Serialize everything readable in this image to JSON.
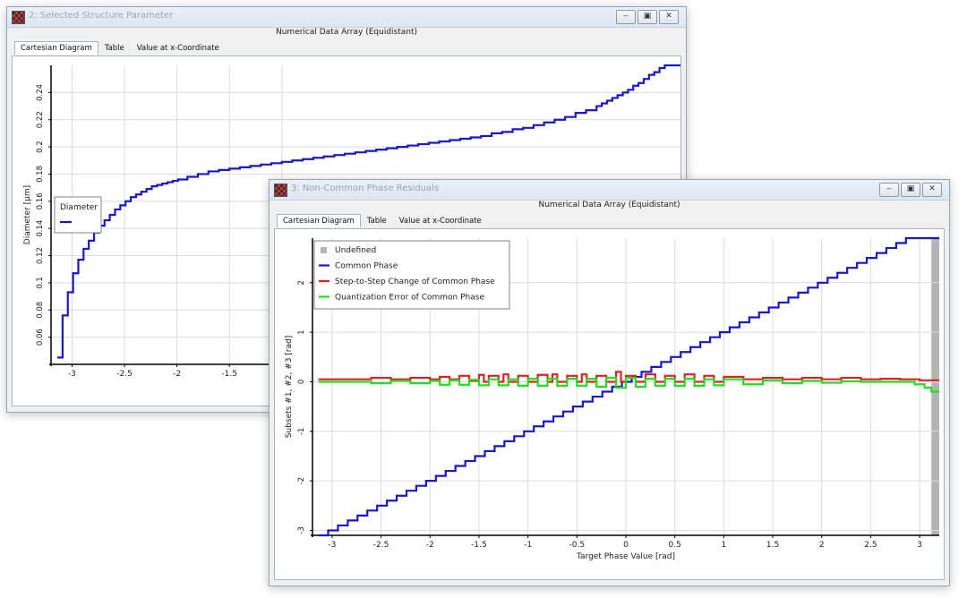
{
  "windows": [
    {
      "title": "2: Selected Structure Parameter",
      "subtitle": "Numerical Data Array (Equidistant)",
      "tabs": [
        "Cartesian Diagram",
        "Table",
        "Value at x-Coordinate"
      ],
      "active_tab": 0,
      "buttons": [
        "minimize",
        "restore",
        "close"
      ]
    },
    {
      "title": "3: Non-Common Phase Residuals",
      "subtitle": "Numerical Data Array (Equidistant)",
      "tabs": [
        "Cartesian Diagram",
        "Table",
        "Value at x-Coordinate"
      ],
      "active_tab": 0,
      "buttons": [
        "minimize",
        "restore",
        "close"
      ]
    }
  ],
  "chart_data": [
    {
      "type": "line",
      "step": true,
      "ylabel": "Diameter [µm]",
      "xlabel": "",
      "xlim": [
        -3.2,
        2.8
      ],
      "ylim": [
        0.04,
        0.26
      ],
      "xticks": [
        -3,
        -2.5,
        -2,
        -1.5,
        -1
      ],
      "xtick_labels": [
        "-3",
        "-2.5",
        "-2",
        "-1.5",
        "-1"
      ],
      "yticks": [
        0.06,
        0.08,
        0.1,
        0.12,
        0.14,
        0.16,
        0.18,
        0.2,
        0.22,
        0.24
      ],
      "ytick_labels": [
        "0.06",
        "0.08",
        "0.1",
        "0.12",
        "0.14",
        "0.16",
        "0.18",
        "0.2",
        "0.22",
        "0.24"
      ],
      "grid": true,
      "legend": {
        "placement": "middle-left",
        "entries": [
          "Diameter"
        ]
      },
      "series": [
        {
          "name": "Diameter",
          "color": "#1818c8",
          "x": [
            -3.14,
            -3.09,
            -3.04,
            -2.99,
            -2.94,
            -2.89,
            -2.84,
            -2.79,
            -2.74,
            -2.69,
            -2.64,
            -2.59,
            -2.54,
            -2.49,
            -2.44,
            -2.39,
            -2.34,
            -2.29,
            -2.24,
            -2.19,
            -2.14,
            -2.09,
            -2.04,
            -1.99,
            -1.9,
            -1.8,
            -1.7,
            -1.6,
            -1.5,
            -1.4,
            -1.3,
            -1.2,
            -1.1,
            -1.0,
            -0.9,
            -0.8,
            -0.7,
            -0.6,
            -0.5,
            -0.4,
            -0.3,
            -0.2,
            -0.1,
            0.0,
            0.1,
            0.2,
            0.3,
            0.4,
            0.5,
            0.6,
            0.7,
            0.8,
            0.9,
            1.0,
            1.1,
            1.2,
            1.3,
            1.4,
            1.5,
            1.6,
            1.7,
            1.8,
            1.9,
            2.0,
            2.05,
            2.1,
            2.15,
            2.2,
            2.25,
            2.3,
            2.35,
            2.4,
            2.45,
            2.5,
            2.55,
            2.6,
            2.65,
            2.7
          ],
          "y": [
            0.045,
            0.076,
            0.093,
            0.107,
            0.117,
            0.125,
            0.131,
            0.137,
            0.142,
            0.146,
            0.15,
            0.154,
            0.157,
            0.16,
            0.163,
            0.165,
            0.167,
            0.169,
            0.171,
            0.172,
            0.173,
            0.174,
            0.175,
            0.176,
            0.178,
            0.18,
            0.182,
            0.183,
            0.184,
            0.185,
            0.186,
            0.187,
            0.188,
            0.189,
            0.19,
            0.191,
            0.192,
            0.193,
            0.194,
            0.195,
            0.196,
            0.197,
            0.198,
            0.199,
            0.2,
            0.201,
            0.202,
            0.203,
            0.204,
            0.205,
            0.206,
            0.207,
            0.208,
            0.21,
            0.211,
            0.213,
            0.214,
            0.216,
            0.218,
            0.22,
            0.222,
            0.225,
            0.227,
            0.23,
            0.232,
            0.234,
            0.236,
            0.238,
            0.24,
            0.242,
            0.245,
            0.247,
            0.25,
            0.253,
            0.255,
            0.258,
            0.26,
            0.26
          ]
        }
      ]
    },
    {
      "type": "line",
      "step": true,
      "xlabel": "Target Phase Value [rad]",
      "ylabel": "Subsets #1, #2, #3 [rad]",
      "xlim": [
        -3.2,
        3.2
      ],
      "ylim": [
        -3.1,
        2.9
      ],
      "xticks": [
        -3,
        -2.5,
        -2,
        -1.5,
        -1,
        -0.5,
        0,
        0.5,
        1,
        1.5,
        2,
        2.5,
        3
      ],
      "xtick_labels": [
        "-3",
        "-2.5",
        "-2",
        "-1.5",
        "-1",
        "-0.5",
        "0",
        "0.5",
        "1",
        "1.5",
        "2",
        "2.5",
        "3"
      ],
      "yticks": [
        -3,
        -2,
        -1,
        0,
        1,
        2
      ],
      "ytick_labels": [
        "-3",
        "-2",
        "-1",
        "0",
        "1",
        "2"
      ],
      "grid": true,
      "legend": {
        "placement": "top-left",
        "entries": [
          "Undefined",
          "Common Phase",
          "Step-to-Step Change of Common Phase",
          "Quantization Error of Common Phase"
        ]
      },
      "series": [
        {
          "name": "Undefined",
          "color": "#b4b4b4",
          "region": [
            3.12,
            3.2
          ]
        },
        {
          "name": "Common Phase",
          "color": "#1818c8",
          "x": [
            -3.14,
            -3.04,
            -2.94,
            -2.84,
            -2.74,
            -2.64,
            -2.54,
            -2.44,
            -2.34,
            -2.24,
            -2.14,
            -2.04,
            -1.94,
            -1.84,
            -1.74,
            -1.64,
            -1.54,
            -1.44,
            -1.34,
            -1.24,
            -1.14,
            -1.04,
            -0.94,
            -0.84,
            -0.74,
            -0.64,
            -0.54,
            -0.44,
            -0.34,
            -0.24,
            -0.14,
            -0.04,
            0.06,
            0.16,
            0.26,
            0.36,
            0.46,
            0.56,
            0.66,
            0.76,
            0.86,
            0.96,
            1.06,
            1.16,
            1.26,
            1.36,
            1.46,
            1.56,
            1.66,
            1.76,
            1.86,
            1.96,
            2.06,
            2.16,
            2.26,
            2.36,
            2.46,
            2.56,
            2.66,
            2.76,
            2.86,
            2.96,
            3.06
          ],
          "y": [
            -3.1,
            -3.0,
            -2.9,
            -2.8,
            -2.7,
            -2.6,
            -2.5,
            -2.4,
            -2.3,
            -2.2,
            -2.1,
            -2.0,
            -1.9,
            -1.8,
            -1.7,
            -1.6,
            -1.5,
            -1.4,
            -1.3,
            -1.2,
            -1.1,
            -1.0,
            -0.9,
            -0.8,
            -0.7,
            -0.6,
            -0.5,
            -0.4,
            -0.3,
            -0.2,
            -0.1,
            0.0,
            0.1,
            0.2,
            0.3,
            0.4,
            0.5,
            0.6,
            0.7,
            0.8,
            0.9,
            1.0,
            1.1,
            1.2,
            1.3,
            1.4,
            1.5,
            1.6,
            1.7,
            1.8,
            1.9,
            2.0,
            2.1,
            2.2,
            2.3,
            2.4,
            2.5,
            2.6,
            2.7,
            2.8,
            2.9,
            2.9,
            2.9
          ]
        },
        {
          "name": "Step-to-Step Change of Common Phase",
          "color": "#e02020",
          "x": [
            -3.14,
            -2.8,
            -2.6,
            -2.4,
            -2.2,
            -2.0,
            -1.9,
            -1.8,
            -1.7,
            -1.6,
            -1.5,
            -1.45,
            -1.4,
            -1.3,
            -1.25,
            -1.2,
            -1.1,
            -1.0,
            -0.9,
            -0.8,
            -0.75,
            -0.7,
            -0.6,
            -0.5,
            -0.45,
            -0.4,
            -0.3,
            -0.2,
            -0.1,
            -0.05,
            0.0,
            0.1,
            0.2,
            0.3,
            0.4,
            0.5,
            0.6,
            0.7,
            0.8,
            0.9,
            1.0,
            1.2,
            1.4,
            1.6,
            1.8,
            2.0,
            2.2,
            2.4,
            2.6,
            2.8,
            3.0
          ],
          "y": [
            0.05,
            0.05,
            0.08,
            0.05,
            0.08,
            0.05,
            0.1,
            0.05,
            0.12,
            0.02,
            0.14,
            0.0,
            0.12,
            0.0,
            0.15,
            0.0,
            0.12,
            0.0,
            0.14,
            0.0,
            0.15,
            0.0,
            0.12,
            0.0,
            0.15,
            0.0,
            0.12,
            0.0,
            0.2,
            0.0,
            0.12,
            0.0,
            0.15,
            0.0,
            0.12,
            0.0,
            0.15,
            0.0,
            0.12,
            0.0,
            0.1,
            0.05,
            0.08,
            0.05,
            0.08,
            0.05,
            0.08,
            0.05,
            0.06,
            0.05,
            0.03
          ]
        },
        {
          "name": "Quantization Error of Common Phase",
          "color": "#22dd22",
          "x": [
            -3.14,
            -2.8,
            -2.6,
            -2.4,
            -2.2,
            -2.0,
            -1.9,
            -1.8,
            -1.7,
            -1.6,
            -1.5,
            -1.4,
            -1.3,
            -1.2,
            -1.1,
            -1.0,
            -0.9,
            -0.8,
            -0.7,
            -0.6,
            -0.5,
            -0.4,
            -0.3,
            -0.2,
            -0.1,
            0.0,
            0.1,
            0.2,
            0.3,
            0.4,
            0.5,
            0.6,
            0.7,
            0.8,
            0.9,
            1.0,
            1.2,
            1.4,
            1.6,
            1.8,
            2.0,
            2.2,
            2.4,
            2.6,
            2.8,
            2.95,
            3.05,
            3.12
          ],
          "y": [
            0.0,
            0.0,
            -0.03,
            0.02,
            -0.03,
            0.02,
            -0.06,
            0.03,
            -0.06,
            0.04,
            -0.07,
            0.05,
            -0.07,
            0.05,
            -0.08,
            0.06,
            -0.08,
            0.06,
            -0.08,
            0.06,
            -0.08,
            0.06,
            -0.1,
            0.08,
            -0.12,
            0.08,
            -0.1,
            0.06,
            -0.08,
            0.06,
            -0.08,
            0.06,
            -0.08,
            0.05,
            -0.07,
            0.05,
            -0.05,
            0.03,
            -0.03,
            0.02,
            -0.02,
            0.01,
            0.0,
            0.0,
            0.0,
            -0.05,
            -0.12,
            -0.2
          ]
        }
      ]
    }
  ]
}
